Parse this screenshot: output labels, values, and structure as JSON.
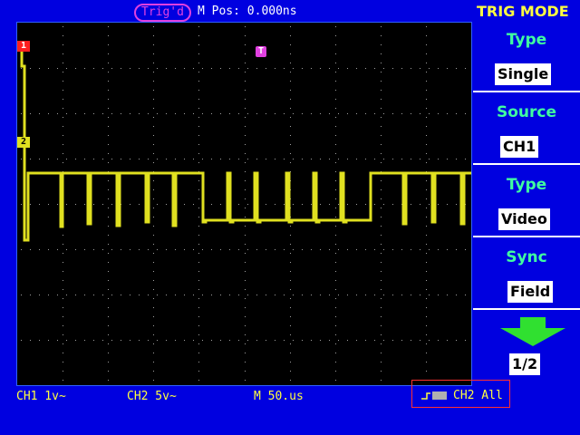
{
  "header": {
    "trig_status": "Trig'd",
    "m_pos": "M Pos: 0.000ns",
    "menu_title": "TRIG MODE"
  },
  "markers": {
    "ch1": "1",
    "ch2": "2",
    "trigger": "T"
  },
  "menu": {
    "items": [
      {
        "label": "Type",
        "value": "Single"
      },
      {
        "label": "Source",
        "value": "CH1"
      },
      {
        "label": "Type",
        "value": "Video"
      },
      {
        "label": "Sync",
        "value": "Field"
      }
    ],
    "page": "1/2"
  },
  "status": {
    "ch1_scale": "CH1 1v~",
    "ch2_scale": "CH2 5v~",
    "time_scale": "M 50.us",
    "trigger_source": "CH2 All"
  },
  "colors": {
    "background": "#0000e0",
    "trace": "#e0e020",
    "grid": "#a0a0a0",
    "label": "#40ffa0"
  }
}
